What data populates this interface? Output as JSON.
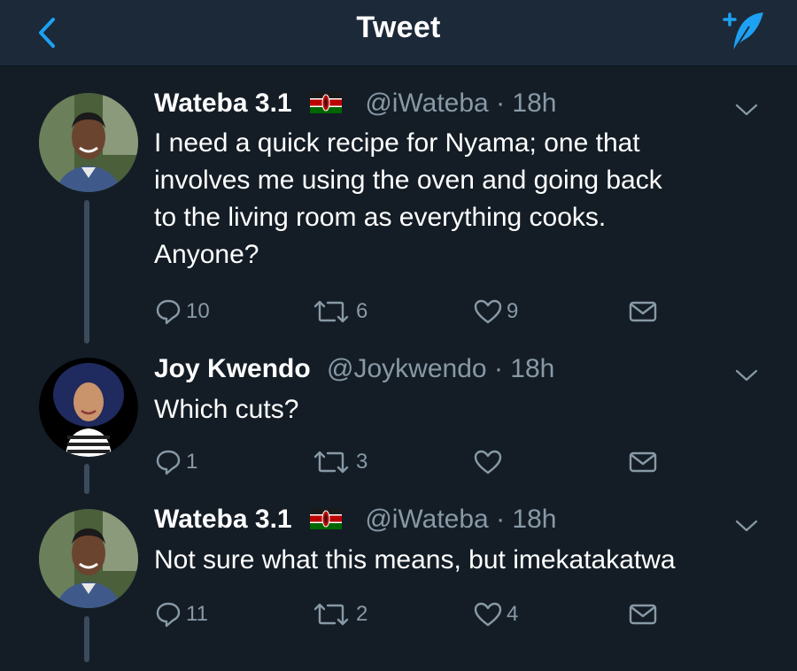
{
  "header": {
    "title": "Tweet",
    "back_icon": "chevron-left-icon",
    "compose_icon": "compose-tweet-icon",
    "accent_color": "#1da1f2"
  },
  "tweets": [
    {
      "name": "Wateba 3.1",
      "flag": "kenya-flag-icon",
      "handle": "@iWateba",
      "time": "18h",
      "text_lines": [
        "I need a quick recipe for Nyama; one that",
        "involves me using the oven and going back",
        "to the living room as everything cooks.",
        "Anyone?"
      ],
      "replies": "10",
      "retweets": "6",
      "likes": "9"
    },
    {
      "name": "Joy Kwendo",
      "handle": "@Joykwendo",
      "time": "18h",
      "text_lines": [
        "Which cuts?"
      ],
      "replies": "1",
      "retweets": "3",
      "likes": ""
    },
    {
      "name": "Wateba 3.1",
      "flag": "kenya-flag-icon",
      "handle": "@iWateba",
      "time": "18h",
      "text_lines": [
        "Not sure what this means, but imekatakatwa"
      ],
      "replies": "11",
      "retweets": "2",
      "likes": "4"
    }
  ],
  "colors": {
    "background": "#141d26",
    "topbar": "#1c2938",
    "muted_text": "#8899a6",
    "flag_red": "#bb0000",
    "flag_green": "#006600"
  }
}
